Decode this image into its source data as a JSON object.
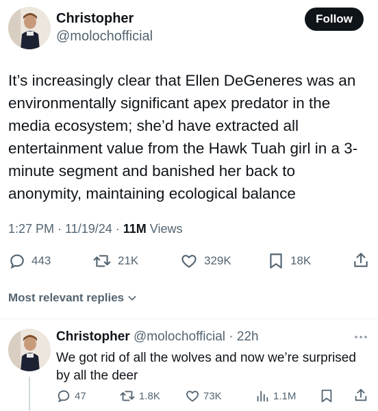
{
  "tweet": {
    "author_name": "Christopher",
    "author_handle": "@molochofficial",
    "follow_label": "Follow",
    "text": "It’s increasingly clear that Ellen DeGeneres was an environmentally significant apex predator in the media ecosystem; she’d have extracted all entertainment value from the Hawk Tuah girl in a 3-minute segment and banished her back to anonymity, maintaining ecological balance",
    "time": "1:27 PM · 11/19/24 · ",
    "views_count": "11M",
    "views_label": " Views",
    "replies": "443",
    "reposts": "21K",
    "likes": "329K",
    "bookmarks": "18K"
  },
  "replies_filter": {
    "label": "Most relevant replies"
  },
  "reply": {
    "author_name": "Christopher",
    "author_handle": "@molochofficial",
    "time": " · 22h",
    "text": "We got rid of all the wolves and now we’re surprised by all the deer",
    "replies": "47",
    "reposts": "1.8K",
    "likes": "73K",
    "views": "1.1M"
  },
  "colors": {
    "text": "#0f1419",
    "secondary": "#536471",
    "button_bg": "#0f1419"
  }
}
